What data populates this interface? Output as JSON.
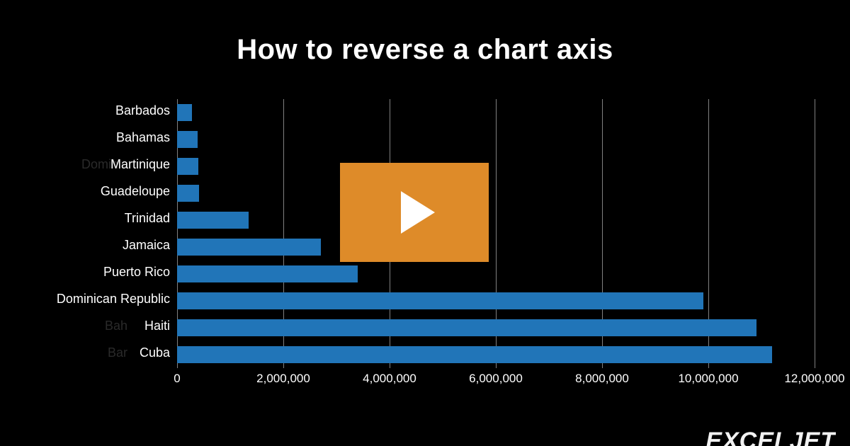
{
  "title": "How to reverse a chart axis",
  "brand": "EXCELJET",
  "chart_data": {
    "type": "bar",
    "categories": [
      "Barbados",
      "Bahamas",
      "Martinique",
      "Guadeloupe",
      "Trinidad",
      "Jamaica",
      "Puerto Rico",
      "Dominican Republic",
      "Haiti",
      "Cuba"
    ],
    "ghost_labels": [
      "",
      "",
      "Dominic",
      "",
      "",
      "",
      "",
      "",
      "Bah",
      "Bar"
    ],
    "values": [
      280000,
      390000,
      400000,
      410000,
      1350000,
      2700000,
      3400000,
      9900000,
      10900000,
      11200000
    ],
    "xlabel": "",
    "ylabel": "",
    "xlim": [
      0,
      12000000
    ],
    "x_ticks": [
      0,
      2000000,
      4000000,
      6000000,
      8000000,
      10000000,
      12000000
    ],
    "x_tick_labels": [
      "0",
      "2,000,000",
      "4,000,000",
      "6,000,000",
      "8,000,000",
      "10,000,000",
      "12,000,000"
    ],
    "bar_color": "#2175b8",
    "grid_color": "#808080"
  },
  "play_button_alt": "Play video"
}
